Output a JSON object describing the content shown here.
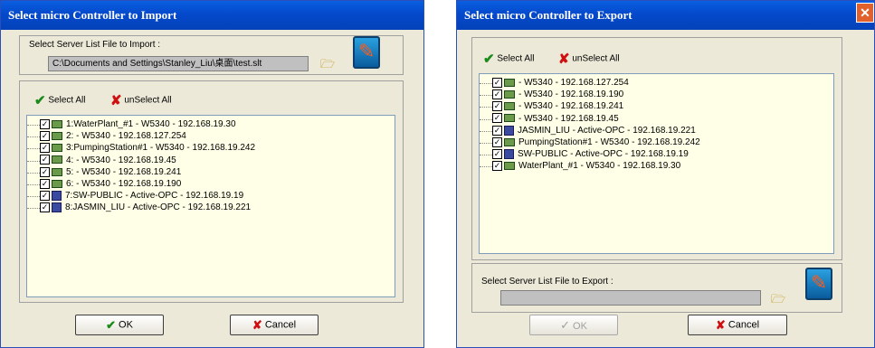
{
  "import": {
    "title": "Select micro Controller to Import",
    "server_label": "Select Server List File to Import :",
    "path_value": "C:\\Documents and Settings\\Stanley_Liu\\桌面\\test.slt",
    "select_all": "Select All",
    "unselect_all": "unSelect All",
    "items": [
      {
        "label": "1:WaterPlant_#1 - W5340 - 192.168.19.30",
        "type": "device"
      },
      {
        "label": "2: - W5340 - 192.168.127.254",
        "type": "device"
      },
      {
        "label": "3:PumpingStation#1 - W5340 - 192.168.19.242",
        "type": "device"
      },
      {
        "label": "4: - W5340 - 192.168.19.45",
        "type": "device"
      },
      {
        "label": "5: - W5340 - 192.168.19.241",
        "type": "device"
      },
      {
        "label": "6: - W5340 - 192.168.19.190",
        "type": "device"
      },
      {
        "label": "7:SW-PUBLIC - Active-OPC - 192.168.19.19",
        "type": "pc"
      },
      {
        "label": "8:JASMIN_LIU - Active-OPC - 192.168.19.221",
        "type": "pc"
      }
    ],
    "ok": "OK",
    "cancel": "Cancel"
  },
  "export": {
    "title": "Select micro Controller to Export",
    "close": "✕",
    "select_all": "Select All",
    "unselect_all": "unSelect All",
    "items": [
      {
        "label": "- W5340 - 192.168.127.254",
        "type": "device"
      },
      {
        "label": "- W5340 - 192.168.19.190",
        "type": "device"
      },
      {
        "label": "- W5340 - 192.168.19.241",
        "type": "device"
      },
      {
        "label": "- W5340 - 192.168.19.45",
        "type": "device"
      },
      {
        "label": "JASMIN_LIU - Active-OPC - 192.168.19.221",
        "type": "pc"
      },
      {
        "label": "PumpingStation#1 - W5340 - 192.168.19.242",
        "type": "device"
      },
      {
        "label": "SW-PUBLIC - Active-OPC - 192.168.19.19",
        "type": "pc"
      },
      {
        "label": "WaterPlant_#1 - W5340 - 192.168.19.30",
        "type": "device"
      }
    ],
    "server_label": "Select Server List File to Export :",
    "path_value": "",
    "ok": "OK",
    "cancel": "Cancel"
  }
}
